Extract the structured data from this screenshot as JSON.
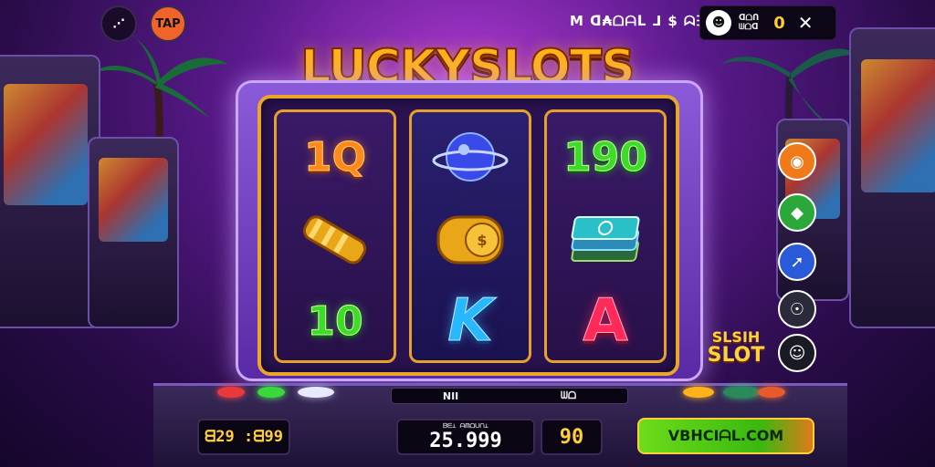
{
  "colors": {
    "accent_gold": "#ffb21c",
    "reel_border": "#e6a12a",
    "cta_green": "#3ab810",
    "purple_bg": "#5a1a8c"
  },
  "topbar": {
    "left_icons": [
      {
        "name": "share-icon",
        "glyph": "⋰"
      },
      {
        "name": "tap-badge-icon",
        "glyph": "TAP"
      }
    ],
    "balance_text": "M ᗡ₳ᗝᗩᒪ ⅃ $ ᗣᗱᔕ",
    "panel": {
      "icon": "☻",
      "label_top": "ᗡᗝᑎ",
      "label_bottom": "ᗯᗝᗡ",
      "value": "0",
      "close": "✕"
    }
  },
  "title": "LUCKYSLOTS",
  "reels": [
    {
      "symbols": [
        {
          "type": "text",
          "text": "1Q",
          "style": "orange"
        },
        {
          "type": "icon",
          "icon": "gold-bars-icon"
        },
        {
          "type": "text",
          "text": "10",
          "style": "green"
        }
      ]
    },
    {
      "symbols": [
        {
          "type": "icon",
          "icon": "planet-gem-icon"
        },
        {
          "type": "icon",
          "icon": "gold-coin-icon"
        },
        {
          "type": "text",
          "text": "K",
          "style": "blue"
        }
      ]
    },
    {
      "symbols": [
        {
          "type": "text",
          "text": "190",
          "style": "green"
        },
        {
          "type": "icon",
          "icon": "card-stack-icon"
        },
        {
          "type": "text",
          "text": "A",
          "style": "red"
        }
      ]
    }
  ],
  "side_buttons": [
    {
      "name": "chat-bubble-icon",
      "glyph": "◉",
      "color": "#f07a1a"
    },
    {
      "name": "gem-icon",
      "glyph": "◆",
      "color": "#2aa83a"
    },
    {
      "name": "arrow-up-icon",
      "glyph": "➚",
      "color": "#2a5ad8"
    },
    {
      "name": "user-icon",
      "glyph": "☉",
      "color": "#2a2a3a"
    },
    {
      "name": "profile-icon",
      "glyph": "☺",
      "color": "#1a1a24"
    }
  ],
  "promo": {
    "line1": "SLSIH",
    "line2": "SLOT"
  },
  "console": {
    "ticker_left": "NII",
    "ticker_right": "ᗯᗝ",
    "balance": "ᗺ29 :ᗺ99",
    "bet": "25.999",
    "bet_label": "ᗷᗴ⊥ ᗩᗰᗝᑌᑎ⊥",
    "win": "90",
    "cta_label": "VBᕼCIᗩL.COM"
  }
}
